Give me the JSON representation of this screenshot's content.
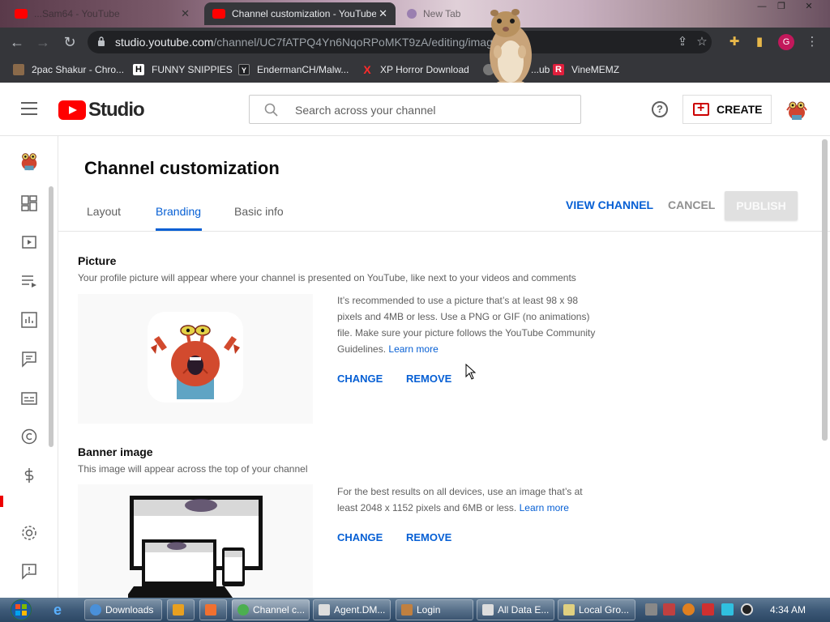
{
  "browser": {
    "tabs": [
      {
        "label": "...Sam64 - YouTube",
        "active": false
      },
      {
        "label": "Channel customization - YouTube",
        "active": true
      },
      {
        "label": "New Tab",
        "active": false
      }
    ],
    "url_host": "studio.youtube.com",
    "url_path": "/channel/UC7fATPQ4Yn6NqoRPoMKT9zA/editing/imag",
    "profile_initial": "G",
    "bookmarks": [
      "2pac Shakur - Chro...",
      "FUNNY SNIPPIES",
      "EndermanCH/Malw...",
      "XP Horror Download",
      "...ub",
      "VineMEMZ"
    ]
  },
  "header": {
    "logo_text": "Studio",
    "search_placeholder": "Search across your channel",
    "create_label": "CREATE",
    "help_glyph": "?"
  },
  "page": {
    "title": "Channel customization",
    "tabs": [
      "Layout",
      "Branding",
      "Basic info"
    ],
    "active_tab": "Branding",
    "view_channel": "VIEW CHANNEL",
    "cancel": "CANCEL",
    "publish": "PUBLISH"
  },
  "picture": {
    "title": "Picture",
    "desc": "Your profile picture will appear where your channel is presented on YouTube, like next to your videos and comments",
    "info": "It’s recommended to use a picture that’s at least 98 x 98 pixels and 4MB or less. Use a PNG or GIF (no animations) file. Make sure your picture follows the YouTube Community Guidelines.",
    "learn_more": "Learn more",
    "change": "CHANGE",
    "remove": "REMOVE"
  },
  "banner": {
    "title": "Banner image",
    "desc": "This image will appear across the top of your channel",
    "info": "For the best results on all devices, use an image that’s at least 2048 x 1152 pixels and 6MB or less.",
    "learn_more": "Learn more",
    "change": "CHANGE",
    "remove": "REMOVE"
  },
  "taskbar": {
    "buttons": [
      "Downloads",
      "Channel c...",
      "Agent.DM...",
      "Login",
      "All Data E...",
      "Local Gro..."
    ],
    "clock": "4:34 AM"
  },
  "colors": {
    "accent_blue": "#065fd4",
    "youtube_red": "#ff0000",
    "chrome_dark": "#35363a"
  }
}
